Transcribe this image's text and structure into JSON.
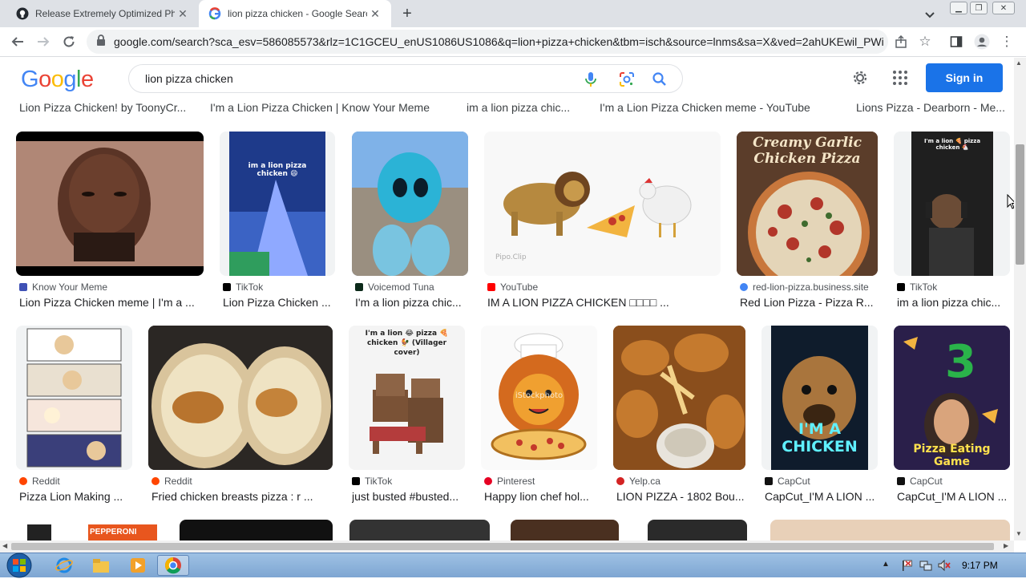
{
  "browser": {
    "tabs": [
      {
        "title": "Release Extremely Optimized Phy",
        "favicon": "github-icon",
        "active": false
      },
      {
        "title": "lion pizza chicken - Google Searc",
        "favicon": "google-icon",
        "active": true
      }
    ],
    "url": "google.com/search?sca_esv=586085573&rlz=1C1GCEU_enUS1086US1086&q=lion+pizza+chicken&tbm=isch&source=lnms&sa=X&ved=2ahUKEwil_PWi..."
  },
  "header": {
    "logo": [
      "G",
      "o",
      "o",
      "g",
      "l",
      "e"
    ],
    "logo_colors": [
      "#4285f4",
      "#ea4335",
      "#fbbc05",
      "#4285f4",
      "#34a853",
      "#ea4335"
    ],
    "query": "lion pizza chicken",
    "signin_label": "Sign in"
  },
  "top_captions": [
    "Lion Pizza Chicken! by ToonyCr...",
    "I'm a Lion Pizza Chicken | Know Your Meme",
    "im a lion pizza chic...",
    "I'm a Lion Pizza Chicken meme - YouTube",
    "Lions Pizza - Dearborn - Me..."
  ],
  "row1": [
    {
      "source": "Know Your Meme",
      "title": "Lion Pizza Chicken meme | I'm a ...",
      "thumb_text": ""
    },
    {
      "source": "TikTok",
      "title": "Lion Pizza Chicken ...",
      "thumb_text": "im a lion pizza chicken 😄"
    },
    {
      "source": "Voicemod Tuna",
      "title": "I'm a lion pizza chic...",
      "thumb_text": ""
    },
    {
      "source": "YouTube",
      "title": "IM A LION PIZZA CHICKEN □□□□ ...",
      "thumb_text": "Pipo.Clip"
    },
    {
      "source": "red-lion-pizza.business.site",
      "title": "Red Lion Pizza - Pizza R...",
      "thumb_text": "Creamy Garlic Chicken Pizza"
    },
    {
      "source": "TikTok",
      "title": "im a lion pizza chic...",
      "thumb_text": "I'm a lion 🍕 pizza chicken 🐔"
    }
  ],
  "row2": [
    {
      "source": "Reddit",
      "title": "Pizza Lion Making ...",
      "thumb_text": ""
    },
    {
      "source": "Reddit",
      "title": "Fried chicken breasts pizza : r ...",
      "thumb_text": ""
    },
    {
      "source": "TikTok",
      "title": "just busted #busted...",
      "thumb_text": "I'm a lion 😂 pizza 🍕 chicken 🐓 (Villager cover)"
    },
    {
      "source": "Pinterest",
      "title": "Happy lion chef hol...",
      "thumb_text": "iStockphoto"
    },
    {
      "source": "Yelp.ca",
      "title": "LION PIZZA - 1802 Bou...",
      "thumb_text": ""
    },
    {
      "source": "CapCut",
      "title": "CapCut_I'M A LION ...",
      "thumb_text": "I'M A CHICKEN"
    },
    {
      "source": "CapCut",
      "title": "CapCut_I'M A LION ...",
      "thumb_text": "Pizza Eating Game"
    }
  ],
  "row3_partial": [
    "PEPPERONI"
  ],
  "taskbar": {
    "time": "9:17 PM"
  }
}
